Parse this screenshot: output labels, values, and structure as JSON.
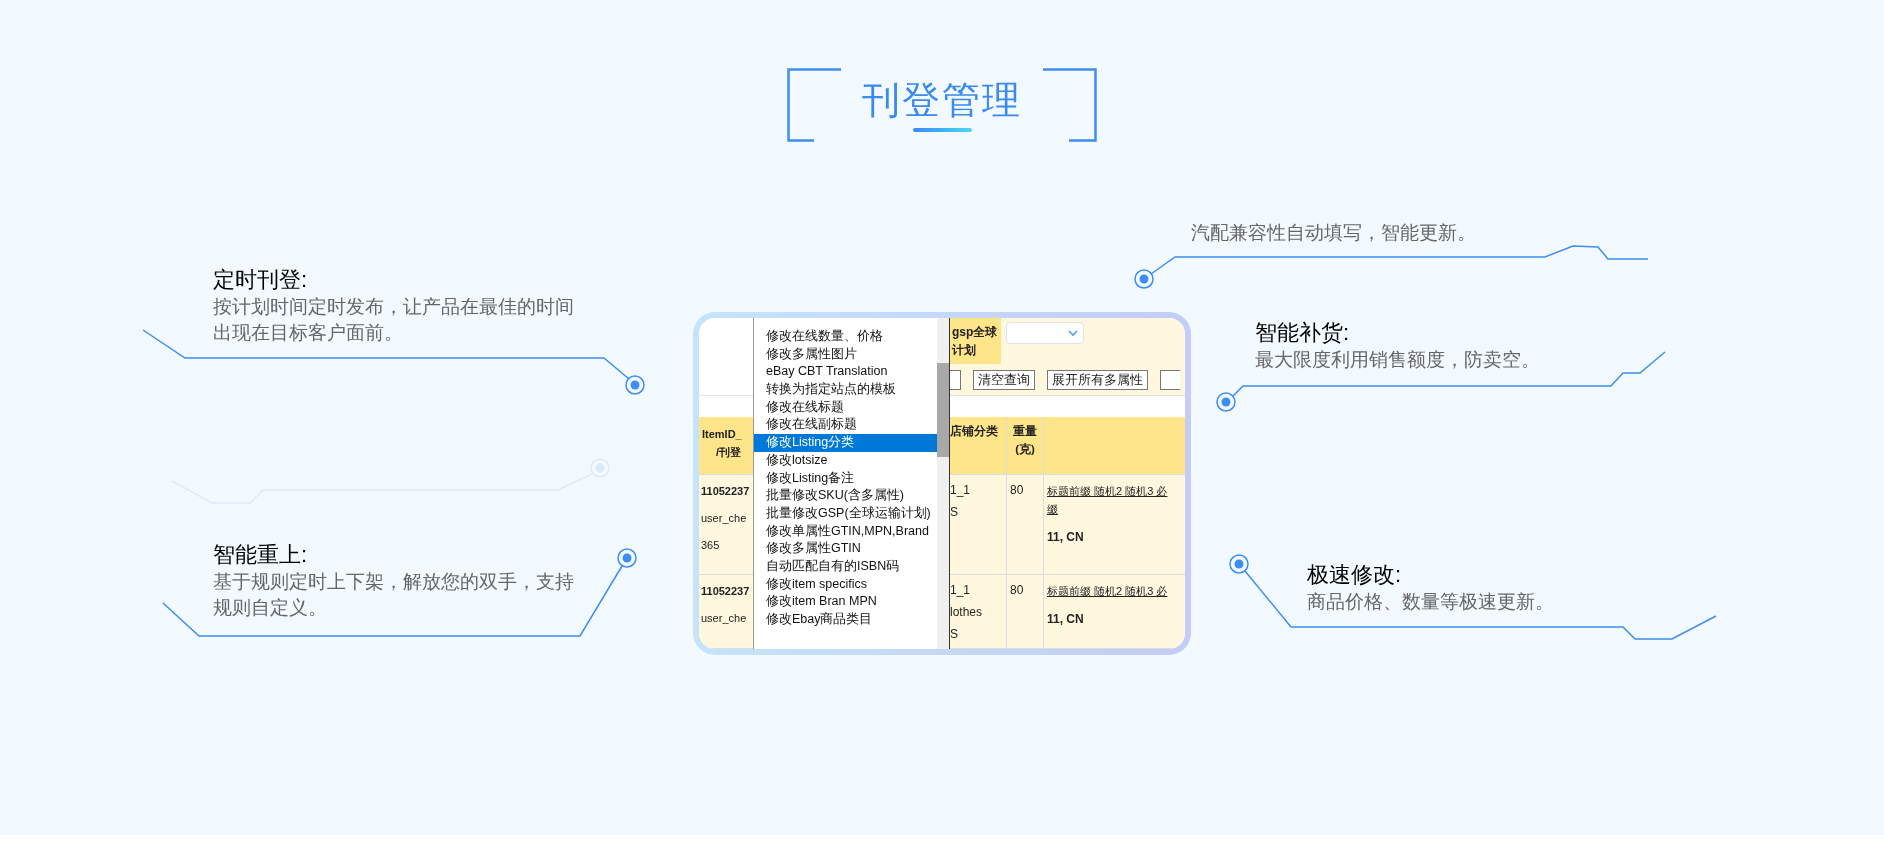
{
  "title": "刊登管理",
  "features": [
    {
      "kind": "titled",
      "title": "定时刊登:",
      "description": "按计划时间定时发布，让产品在最佳的时间出现在目标客户面前。"
    },
    {
      "kind": "titled",
      "title": "智能重上:",
      "description": "基于规则定时上下架，解放您的双手，支持规则自定义。"
    },
    {
      "kind": "plain",
      "description": "汽配兼容性自动填写，智能更新。"
    },
    {
      "kind": "titled",
      "title": "智能补货:",
      "description": "最大限度利用销售额度，防卖空。"
    },
    {
      "kind": "titled",
      "title": "极速修改:",
      "description": "商品价格、数量等极速更新。"
    }
  ],
  "screenshot": {
    "left_column": {
      "header_lines": [
        "ItemID_",
        "/刊登"
      ],
      "rows": [
        {
          "lines": [
            "11052237",
            "user_che",
            "365"
          ]
        },
        {
          "lines": [
            "11052237",
            "user_che"
          ]
        }
      ]
    },
    "menu": {
      "items": [
        {
          "label": "修改在线数量、价格",
          "selected": false
        },
        {
          "label": "修改多属性图片",
          "selected": false
        },
        {
          "label": "eBay CBT Translation",
          "selected": false
        },
        {
          "label": "转换为指定站点的模板",
          "selected": false
        },
        {
          "label": "修改在线标题",
          "selected": false
        },
        {
          "label": "修改在线副标题",
          "selected": false
        },
        {
          "label": "修改Listing分类",
          "selected": true
        },
        {
          "label": "修改lotsize",
          "selected": false
        },
        {
          "label": "修改Listing备注",
          "selected": false
        },
        {
          "label": "批量修改SKU(含多属性)",
          "selected": false
        },
        {
          "label": "批量修改GSP(全球运输计划)",
          "selected": false
        },
        {
          "label": "修改单属性GTIN,MPN,Brand",
          "selected": false
        },
        {
          "label": "修改多属性GTIN",
          "selected": false
        },
        {
          "label": "自动匹配自有的ISBN码",
          "selected": false
        },
        {
          "label": "修改item specifics",
          "selected": false
        },
        {
          "label": "修改item Bran MPN",
          "selected": false
        },
        {
          "label": "修改Ebay商品类目",
          "selected": false
        }
      ]
    },
    "filter_label_lines": [
      "gsp全球",
      "计划"
    ],
    "buttons": [
      "清空查询",
      "展开所有多属性"
    ],
    "columns": [
      {
        "lines": [
          "店铺分类"
        ]
      },
      {
        "lines": [
          "重量",
          "(克)"
        ]
      }
    ],
    "rows": [
      {
        "category_lines": [
          "1_1",
          "S"
        ],
        "weight": "80",
        "title_lines": [
          "标题前缀 随机2 随机3 必",
          "缀"
        ],
        "location": "11, CN"
      },
      {
        "category_lines": [
          "1_1",
          "lothes",
          "S"
        ],
        "weight": "80",
        "title_lines": [
          "标题前缀 随机2 随机3 必"
        ],
        "location": "11, CN"
      }
    ]
  }
}
